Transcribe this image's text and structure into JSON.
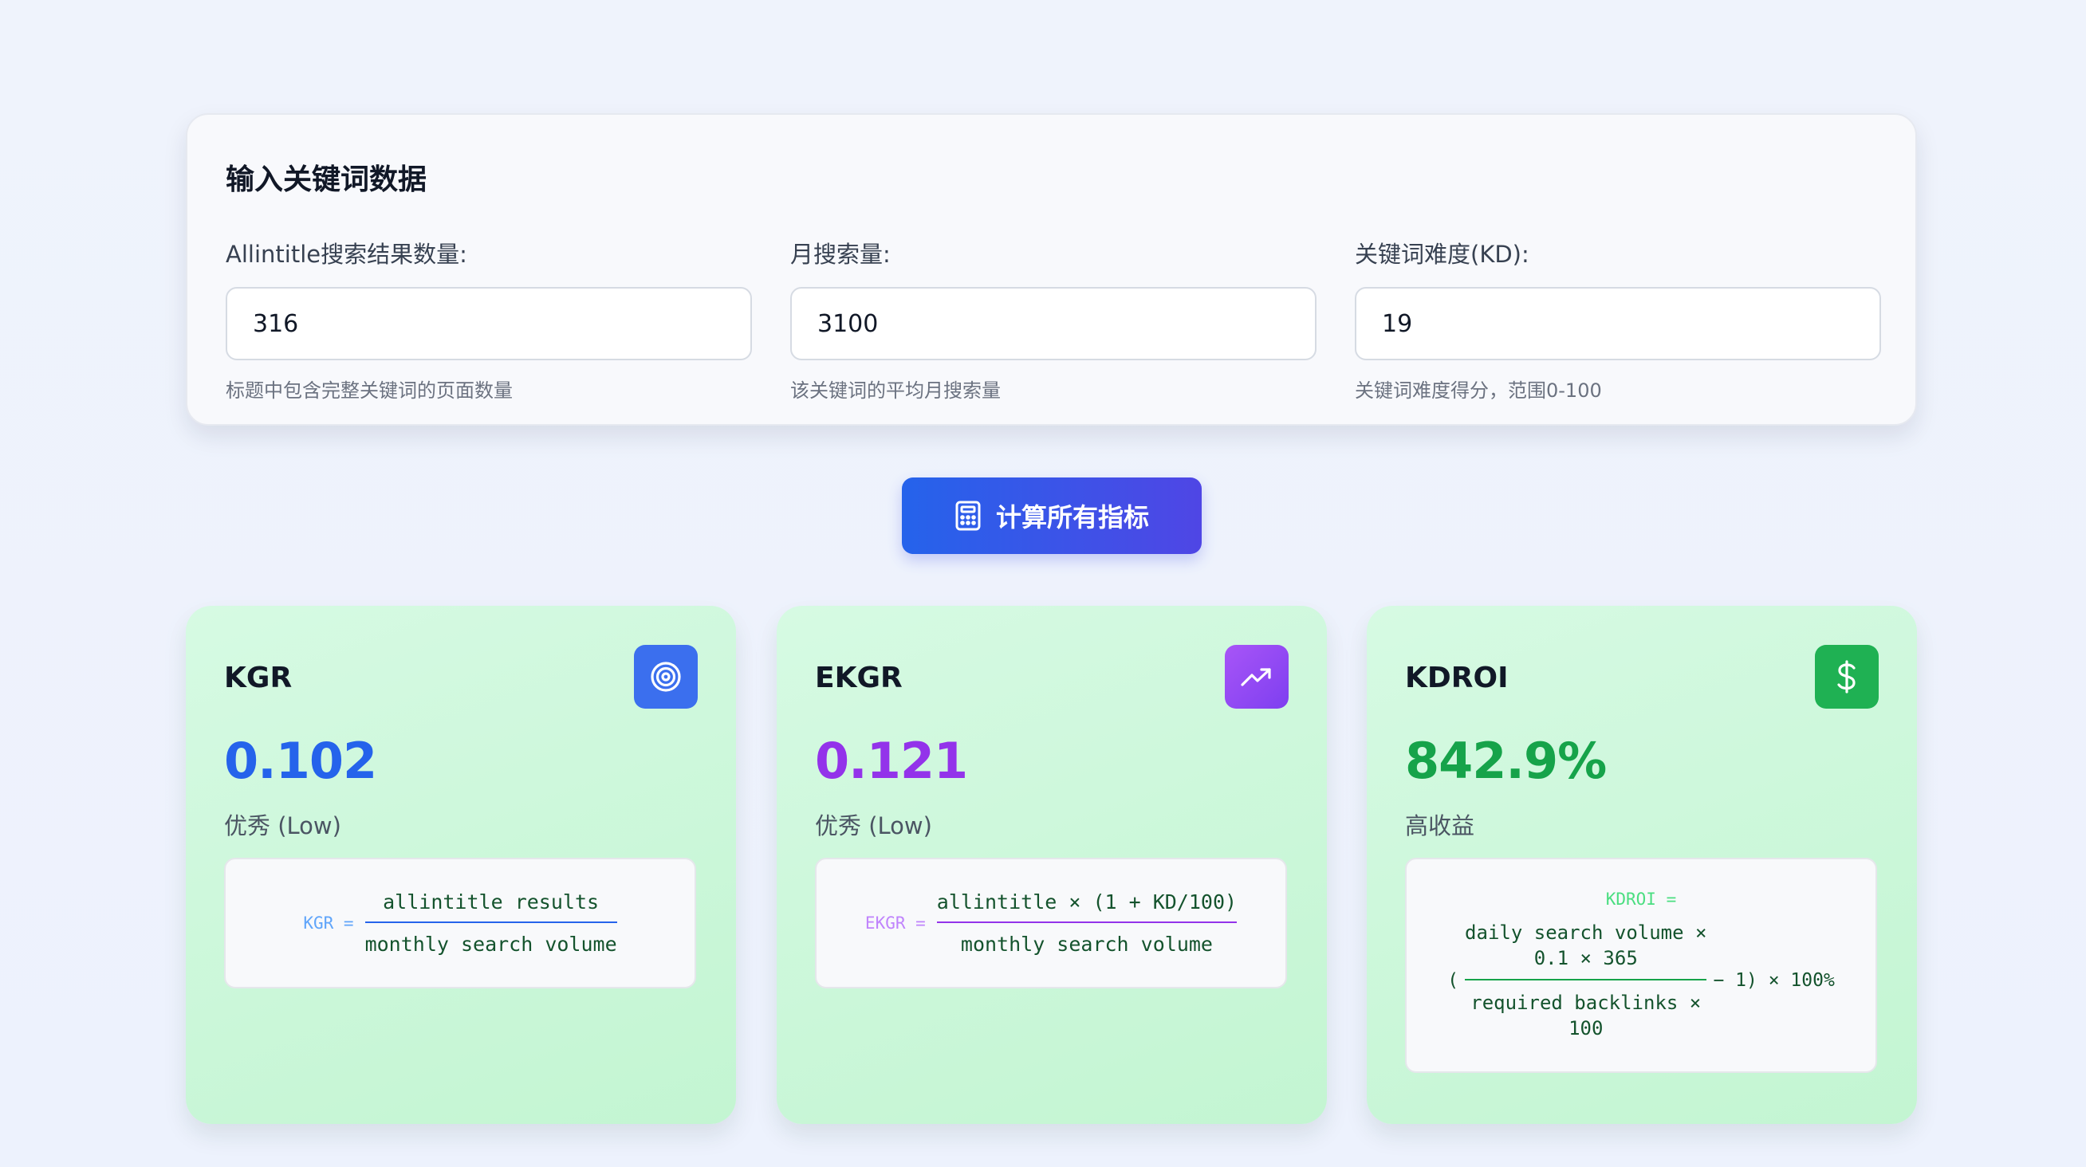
{
  "input_section": {
    "title": "输入关键词数据",
    "fields": [
      {
        "label": "Allintitle搜索结果数量:",
        "value": "316",
        "hint": "标题中包含完整关键词的页面数量"
      },
      {
        "label": "月搜索量:",
        "value": "3100",
        "hint": "该关键词的平均月搜索量"
      },
      {
        "label": "关键词难度(KD):",
        "value": "19",
        "hint": "关键词难度得分，范围0-100"
      }
    ]
  },
  "calculate_button": {
    "label": "计算所有指标",
    "icon": "calculator-icon"
  },
  "metrics": [
    {
      "name": "KGR",
      "value": "0.102",
      "status": "优秀 (Low)",
      "icon": "target-icon",
      "accent": "#2563eb",
      "badge_color": "#3b6fee",
      "formula": {
        "lhs": "KGR =",
        "numerator": "allintitle results",
        "denominator": "monthly search volume"
      }
    },
    {
      "name": "EKGR",
      "value": "0.121",
      "status": "优秀 (Low)",
      "icon": "trending-up-icon",
      "accent": "#9333ea",
      "badge_color": "#9b4bf0",
      "formula": {
        "lhs": "EKGR =",
        "numerator": "allintitle × (1 + KD/100)",
        "denominator": "monthly search volume"
      }
    },
    {
      "name": "KDROI",
      "value": "842.9%",
      "status": "高收益",
      "icon": "dollar-icon",
      "accent": "#16a34a",
      "badge_color": "#1fb153",
      "formula": {
        "lhs": "KDROI =",
        "open": "(",
        "numerator_line1": "daily search volume ×",
        "numerator_line2": "0.1 × 365",
        "denominator_line1": "required backlinks ×",
        "denominator_line2": "100",
        "tail": "− 1) × 100%"
      }
    }
  ]
}
